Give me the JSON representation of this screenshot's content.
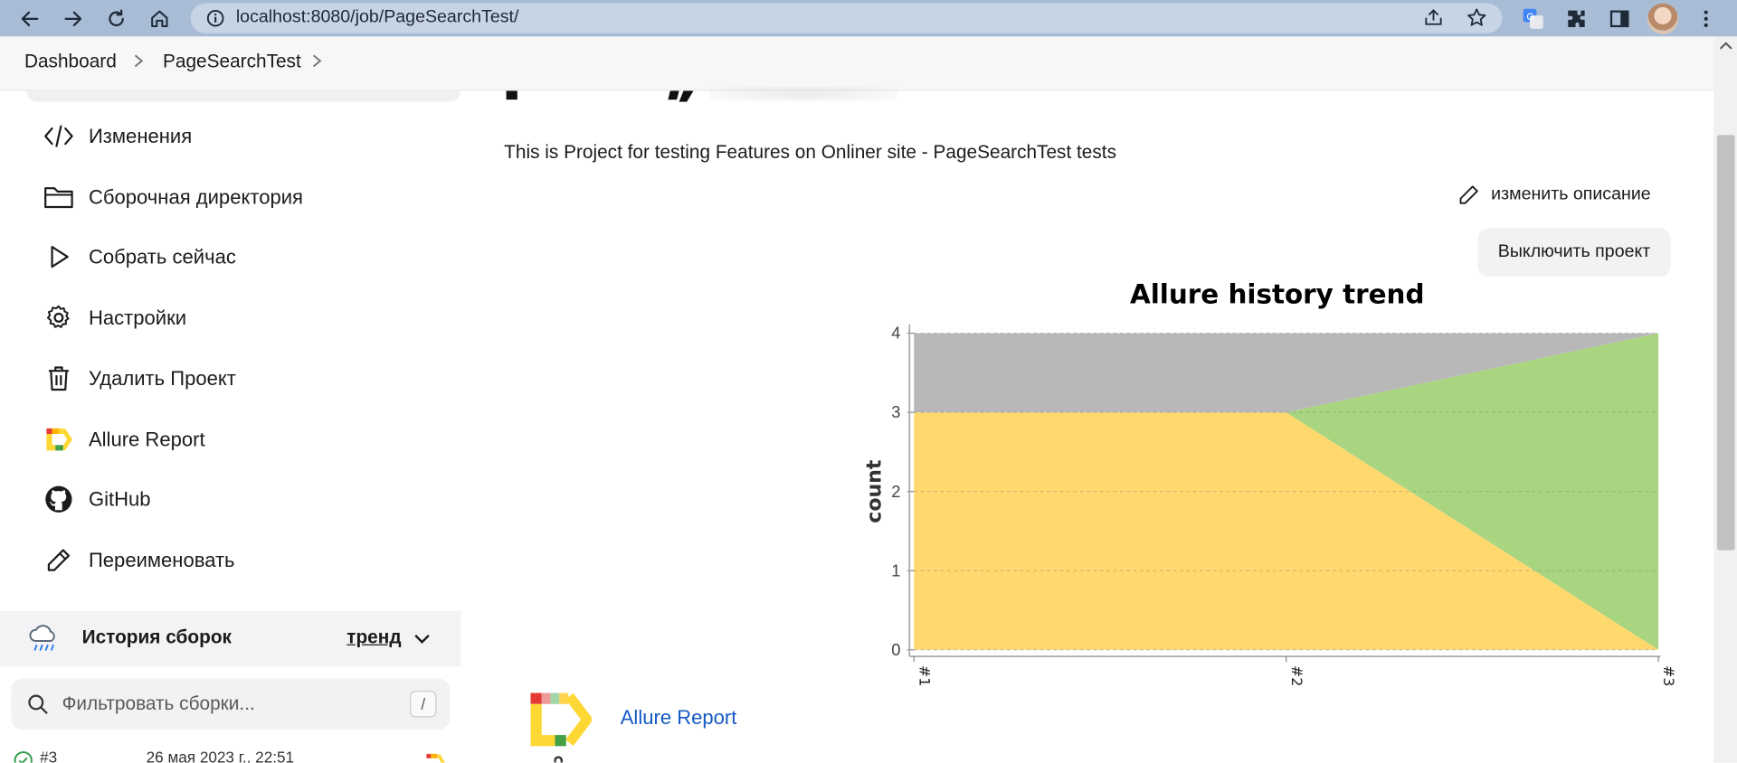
{
  "browser": {
    "url": "localhost:8080/job/PageSearchTest/"
  },
  "breadcrumb": {
    "items": [
      "Dashboard",
      "PageSearchTest"
    ]
  },
  "sidebar": {
    "items": [
      {
        "label": "Изменения",
        "icon": "code-icon"
      },
      {
        "label": "Сборочная директория",
        "icon": "folder-icon"
      },
      {
        "label": "Собрать сейчас",
        "icon": "play-icon"
      },
      {
        "label": "Настройки",
        "icon": "gear-icon"
      },
      {
        "label": "Удалить Проект",
        "icon": "trash-icon"
      },
      {
        "label": "Allure Report",
        "icon": "allure-icon"
      },
      {
        "label": "GitHub",
        "icon": "github-icon"
      },
      {
        "label": "Переименовать",
        "icon": "pencil-icon"
      }
    ]
  },
  "history": {
    "title": "История сборок",
    "trend_label": "тренд",
    "filter_placeholder": "Фильтровать сборки...",
    "filter_shortcut": "/",
    "builds": [
      {
        "number": "#3",
        "date": "26 мая 2023 г., 22:51"
      }
    ]
  },
  "main": {
    "description": "This is Project for testing Features on Onliner site - PageSearchTest tests",
    "edit_description_label": "изменить описание",
    "disable_project_label": "Выключить проект",
    "allure_report_link": "Allure Report"
  },
  "chart_data": {
    "type": "area",
    "title": "Allure history trend",
    "ylabel": "count",
    "xlabel": "",
    "categories": [
      "#1",
      "#2",
      "#3"
    ],
    "yticks": [
      0,
      1,
      2,
      3,
      4
    ],
    "ylim": [
      0,
      4
    ],
    "stacked": true,
    "grid": true,
    "series": [
      {
        "values": [
          3,
          3,
          0
        ],
        "color": "#ffd86e"
      },
      {
        "values": [
          0,
          0,
          4
        ],
        "color": "#aad580"
      },
      {
        "values": [
          1,
          1,
          0
        ],
        "color": "#b8b8b8"
      }
    ]
  },
  "colors": {
    "link": "#1559c4",
    "browser_bar": "#a8bcd6",
    "failed": "#ffd86e",
    "passed": "#aad580",
    "unknown": "#b8b8b8"
  }
}
